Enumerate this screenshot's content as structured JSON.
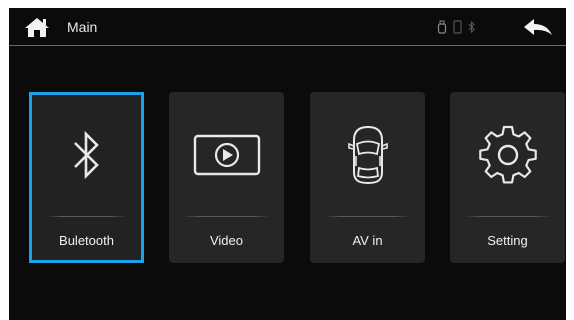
{
  "header": {
    "title": "Main",
    "home_icon": "home-icon",
    "back_icon": "back-arrow-icon",
    "status_icons": [
      "usb-icon",
      "phone-icon",
      "bluetooth-status-icon"
    ]
  },
  "tiles": [
    {
      "label": "Buletooth",
      "icon": "bluetooth-icon",
      "selected": true
    },
    {
      "label": "Video",
      "icon": "video-play-icon",
      "selected": false
    },
    {
      "label": "AV in",
      "icon": "car-icon",
      "selected": false
    },
    {
      "label": "Setting",
      "icon": "gear-icon",
      "selected": false
    }
  ],
  "colors": {
    "background": "#0b0b0b",
    "tile": "#262626",
    "selection": "#1aa3e8",
    "text": "#f0f0f0"
  }
}
